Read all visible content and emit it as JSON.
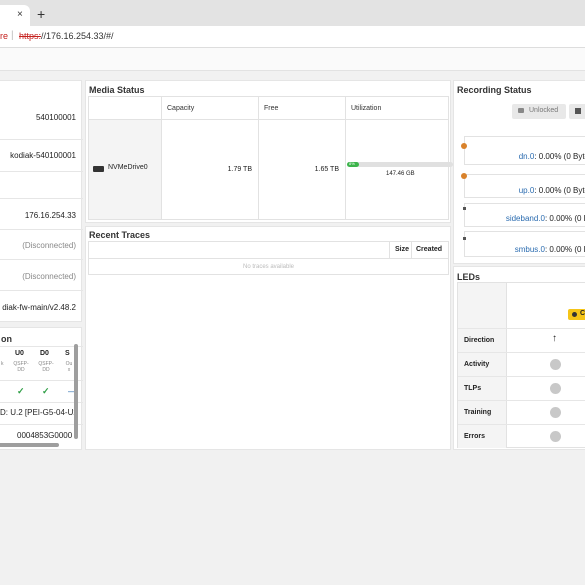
{
  "browser": {
    "tab_close": "×",
    "new_tab": "+",
    "url_insecure": "re",
    "url_sep": "|",
    "url_scheme": "https:",
    "url_rest": "//176.16.254.33/#/"
  },
  "device_info": {
    "values": [
      "540100001",
      "kodiak-540100001",
      "",
      "176.16.254.33",
      "(Disconnected)",
      "(Disconnected)",
      "diak-fw-main/v2.48.2"
    ]
  },
  "connection": {
    "title": "on",
    "col_headers": [
      "U0",
      "D0",
      "S"
    ],
    "sub_left": "k",
    "col_sub": [
      "QSFP-\nDD",
      "QSFP-\nDD",
      "Ou\nx"
    ],
    "checks": [
      "✓",
      "✓",
      "—"
    ],
    "line1": "D: U.2 [PEI-G5-04-U2",
    "line2": "0004853G0000"
  },
  "media_status": {
    "title": "Media Status",
    "headers": [
      "",
      "Capacity",
      "Free",
      "Utilization"
    ],
    "drive": "NVMeDrive0",
    "capacity": "1.79 TB",
    "free": "1.65 TB",
    "util_pct_label": "8%",
    "util_fraction": 0.08,
    "used": "147.46 GB"
  },
  "recent_traces": {
    "title": "Recent Traces",
    "headers": [
      "Size",
      "Created"
    ],
    "empty": "No traces available"
  },
  "recording_status": {
    "title": "Recording Status",
    "unlocked_label": "Unlocked",
    "channels": [
      {
        "name": "dn.0",
        "rest": ": 0.00% (0 Byte"
      },
      {
        "name": "up.0",
        "rest": ": 0.00% (0 Byte"
      },
      {
        "name": "sideband.0",
        "rest": ": 0.00% (0 B"
      },
      {
        "name": "smbus.0",
        "rest": ": 0.00% (0 B"
      }
    ]
  },
  "leds": {
    "title": "LEDs",
    "badge": "C",
    "rows": [
      "Direction",
      "Activity",
      "TLPs",
      "Training",
      "Errors"
    ],
    "direction_arrow": "↑"
  },
  "colors": {
    "accent": "#2b6cb0",
    "bar_green": "#3cb44b",
    "badge_yellow": "#f5c518",
    "alert": "#c5221f"
  }
}
